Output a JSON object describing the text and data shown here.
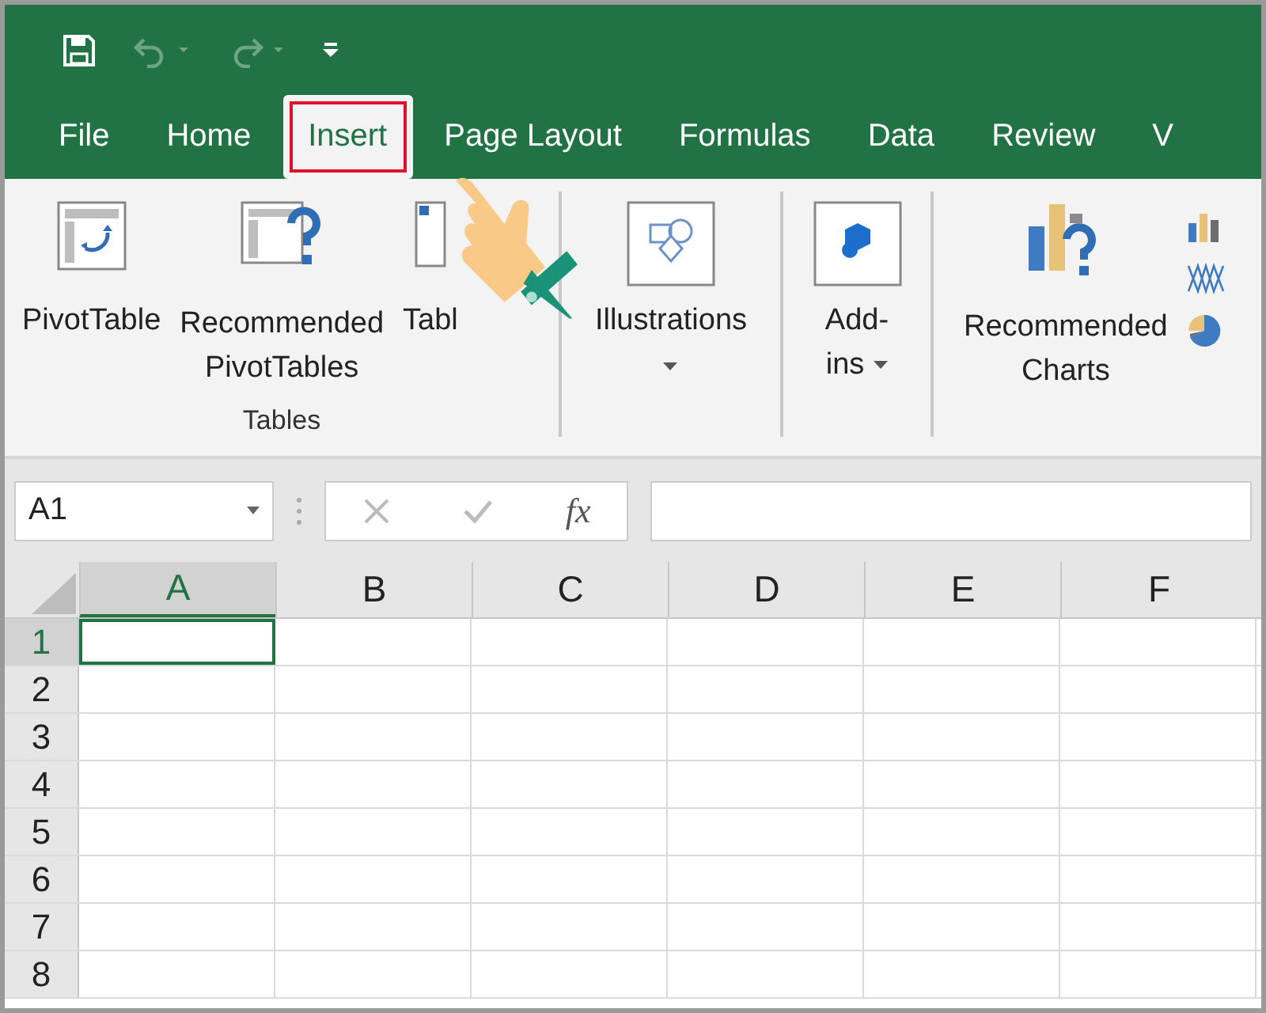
{
  "quick_access": [
    {
      "kind": "save",
      "disabled": false
    },
    {
      "kind": "undo",
      "disabled": true
    },
    {
      "kind": "redo",
      "disabled": true
    },
    {
      "kind": "customize",
      "disabled": false
    }
  ],
  "tabs": [
    {
      "label": "File",
      "selected": false,
      "highlighted": false
    },
    {
      "label": "Home",
      "selected": false,
      "highlighted": false
    },
    {
      "label": "Insert",
      "selected": true,
      "highlighted": true
    },
    {
      "label": "Page Layout",
      "selected": false,
      "highlighted": false
    },
    {
      "label": "Formulas",
      "selected": false,
      "highlighted": false
    },
    {
      "label": "Data",
      "selected": false,
      "highlighted": false
    },
    {
      "label": "Review",
      "selected": false,
      "highlighted": false
    },
    {
      "label": "V",
      "selected": false,
      "highlighted": false
    }
  ],
  "ribbon": {
    "groups": [
      {
        "label": "Tables",
        "buttons": [
          {
            "kind": "pivot",
            "lines": [
              "PivotTable"
            ],
            "dropdown": false
          },
          {
            "kind": "recommended-pivot",
            "lines": [
              "Recommended",
              "PivotTables"
            ],
            "dropdown": false
          },
          {
            "kind": "table",
            "lines": [
              "Tabl"
            ],
            "dropdown": false
          }
        ]
      },
      {
        "buttons": [
          {
            "kind": "illustrations",
            "lines": [
              "Illustrations"
            ],
            "dropdown": true
          }
        ]
      },
      {
        "buttons": [
          {
            "kind": "addins",
            "lines": [
              "Add-",
              "ins"
            ],
            "dropdown": true
          }
        ]
      },
      {
        "buttons": [
          {
            "kind": "recommended-charts",
            "lines": [
              "Recommended",
              "Charts"
            ],
            "dropdown": false
          },
          {
            "kind": "chart-stack"
          }
        ]
      }
    ]
  },
  "formula_bar": {
    "name_box": "A1",
    "function_label": "fx"
  },
  "sheet": {
    "columns": [
      {
        "label": "A",
        "selected": true
      },
      {
        "label": "B",
        "selected": false
      },
      {
        "label": "C",
        "selected": false
      },
      {
        "label": "D",
        "selected": false
      },
      {
        "label": "E",
        "selected": false
      },
      {
        "label": "F",
        "selected": false
      }
    ],
    "rows": [
      {
        "label": "1",
        "selected": true
      },
      {
        "label": "2",
        "selected": false
      },
      {
        "label": "3",
        "selected": false
      },
      {
        "label": "4",
        "selected": false
      },
      {
        "label": "5",
        "selected": false
      },
      {
        "label": "6",
        "selected": false
      },
      {
        "label": "7",
        "selected": false
      },
      {
        "label": "8",
        "selected": false
      }
    ]
  },
  "pointer": {
    "kind": "hand"
  }
}
